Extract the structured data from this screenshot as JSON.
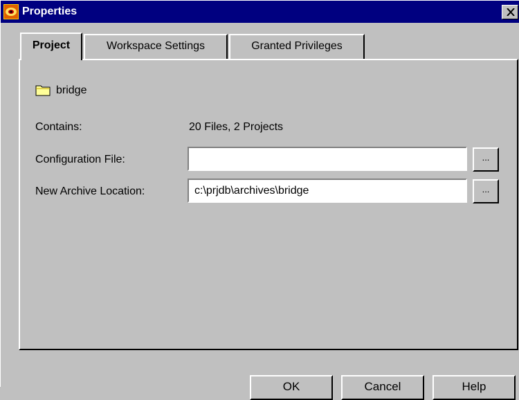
{
  "window": {
    "title": "Properties",
    "close_glyph": "✕"
  },
  "tabs": [
    {
      "label": "Project",
      "active": true
    },
    {
      "label": "Workspace Settings",
      "active": false
    },
    {
      "label": "Granted Privileges",
      "active": false
    }
  ],
  "project": {
    "folder_icon": "folder-icon",
    "name": "bridge",
    "contains_label": "Contains:",
    "contains_value": "20 Files, 2 Projects",
    "config_label": "Configuration File:",
    "config_value": "",
    "archive_label": "New Archive Location:",
    "archive_value": "c:\\prjdb\\archives\\bridge",
    "browse_label": "..."
  },
  "buttons": {
    "ok": "OK",
    "cancel": "Cancel",
    "help": "Help"
  },
  "colors": {
    "titlebar": "#000080",
    "face": "#c0c0c0",
    "folder": "#ffff99"
  }
}
